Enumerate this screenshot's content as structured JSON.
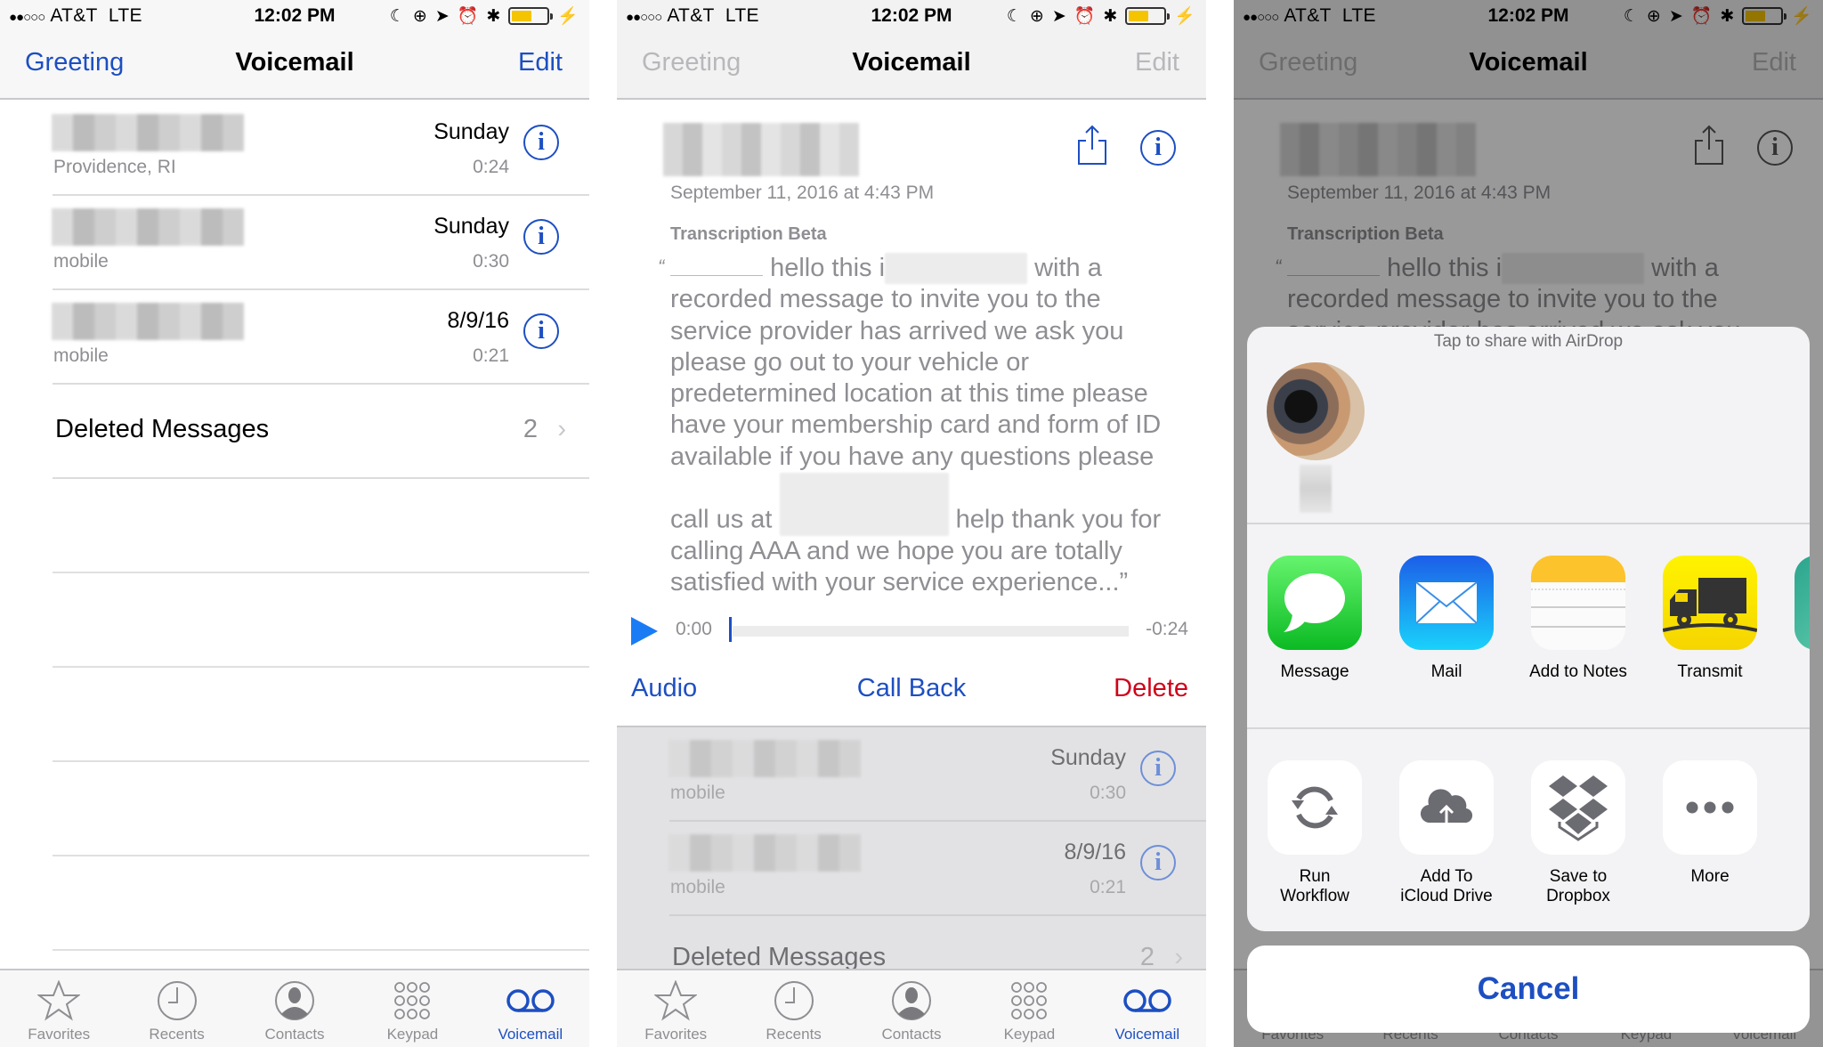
{
  "status_bar": {
    "signal": "●●○○○",
    "carrier": "AT&T",
    "network": "LTE",
    "time": "12:02 PM",
    "battery_level": 0.55,
    "battery_color": "#f5c400"
  },
  "nav": {
    "left": "Greeting",
    "title": "Voicemail",
    "right": "Edit"
  },
  "voicemails": [
    {
      "name": "[redacted]",
      "subtitle": "Providence, RI",
      "date": "Sunday",
      "duration": "0:24"
    },
    {
      "name": "[redacted]",
      "subtitle": "mobile",
      "date": "Sunday",
      "duration": "0:30"
    },
    {
      "name": "[redacted]",
      "subtitle": "mobile",
      "date": "8/9/16",
      "duration": "0:21"
    }
  ],
  "deleted": {
    "label": "Deleted Messages",
    "count": "2",
    "chevron": "›"
  },
  "tabs": [
    {
      "label": "Favorites",
      "icon": "star-icon",
      "active": false
    },
    {
      "label": "Recents",
      "icon": "clock-icon",
      "active": false
    },
    {
      "label": "Contacts",
      "icon": "person-icon",
      "active": false
    },
    {
      "label": "Keypad",
      "icon": "keypad-icon",
      "active": false
    },
    {
      "label": "Voicemail",
      "icon": "voicemail-icon",
      "active": true
    }
  ],
  "detail": {
    "datetime": "September 11, 2016 at 4:43 PM",
    "transcription_label": "Transcription Beta",
    "open_quote": "“",
    "transcript_parts": {
      "p1": "hello this i",
      "p1_redact": "s [redacted]",
      "p2": "with a recorded message to invite you to the service provider has arrived we ask you please go out to your vehicle or predetermined location at this time please have your membership card and form of ID available if you have any questions please call us at",
      "p2_redact": "[redacted number]",
      "p3": "help thank you for calling AAA and we hope you are totally satisfied with your service experience...”"
    },
    "player": {
      "current": "0:00",
      "remaining": "-0:24",
      "progress": 0.0
    },
    "actions": {
      "audio": "Audio",
      "call_back": "Call Back",
      "delete": "Delete"
    }
  },
  "share_sheet": {
    "airdrop_hint": "Tap to share with AirDrop",
    "airdrop_person": "[redacted]",
    "apps": [
      {
        "label": "Message",
        "icon": "messages-app-icon"
      },
      {
        "label": "Mail",
        "icon": "mail-app-icon"
      },
      {
        "label": "Add to Notes",
        "icon": "notes-app-icon"
      },
      {
        "label": "Transmit",
        "icon": "transmit-app-icon"
      }
    ],
    "actions": [
      {
        "label": "Run Workflow",
        "line1": "Run",
        "line2": "Workflow",
        "icon": "workflow-icon"
      },
      {
        "label": "Add To iCloud Drive",
        "line1": "Add To",
        "line2": "iCloud Drive",
        "icon": "cloud-upload-icon"
      },
      {
        "label": "Save to Dropbox",
        "line1": "Save to",
        "line2": "Dropbox",
        "icon": "dropbox-icon"
      },
      {
        "label": "More",
        "line1": "More",
        "line2": "",
        "icon": "more-icon"
      }
    ],
    "cancel": "Cancel"
  },
  "colors": {
    "accent_blue": "#1d4fc2",
    "delete_red": "#d0021b",
    "play_blue": "#1a7cf5"
  }
}
